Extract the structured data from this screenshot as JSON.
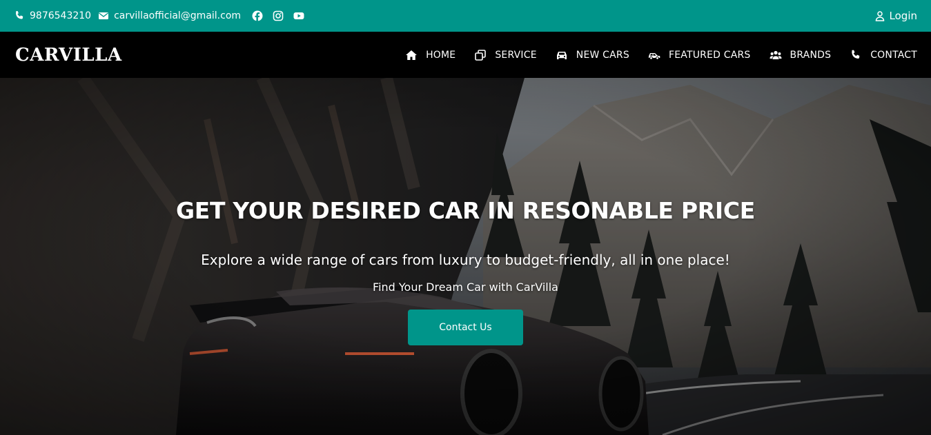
{
  "topbar": {
    "phone": "9876543210",
    "email": "carvillaofficial@gmail.com",
    "social": [
      "facebook-icon",
      "instagram-icon",
      "youtube-icon"
    ],
    "login_label": "Login"
  },
  "navbar": {
    "brand": "CARVILLA",
    "items": [
      {
        "label": "HOME",
        "icon": "home-icon"
      },
      {
        "label": "SERVICE",
        "icon": "copy-icon"
      },
      {
        "label": "NEW CARS",
        "icon": "car-icon"
      },
      {
        "label": "FEATURED CARS",
        "icon": "car-side-icon"
      },
      {
        "label": "BRANDS",
        "icon": "users-icon"
      },
      {
        "label": "CONTACT",
        "icon": "phone-icon"
      }
    ]
  },
  "hero": {
    "title": "GET YOUR DESIRED CAR IN RESONABLE PRICE",
    "subtitle": "Explore a wide range of cars from luxury to budget-friendly, all in one place!",
    "tagline": "Find Your Dream Car with CarVilla",
    "button_label": "Contact Us"
  },
  "colors": {
    "accent": "#00958a",
    "nav_bg": "#000000",
    "text": "#ffffff"
  }
}
